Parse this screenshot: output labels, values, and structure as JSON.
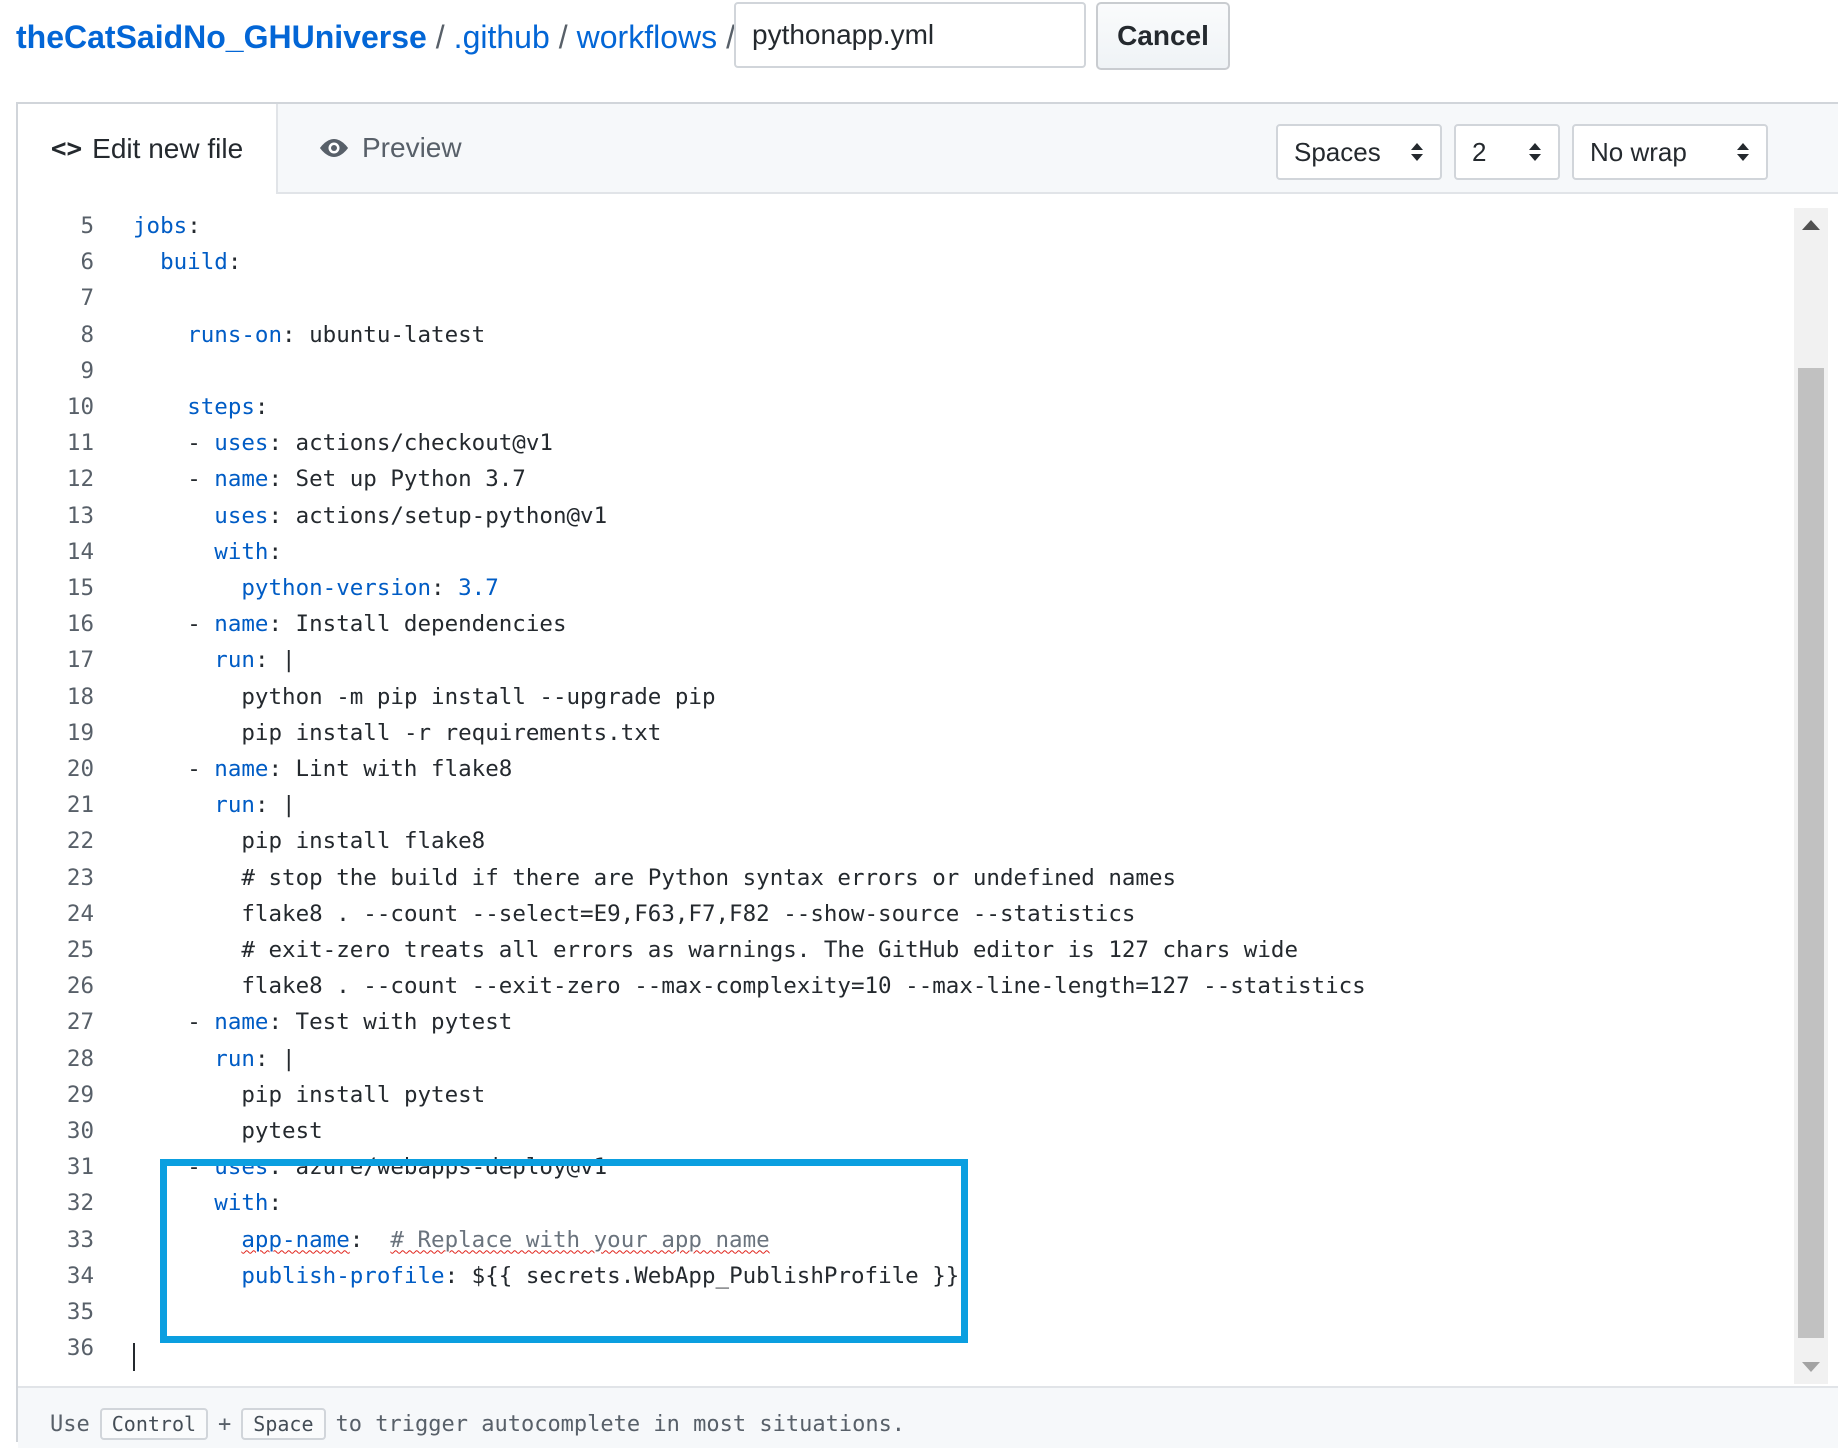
{
  "breadcrumb": {
    "repo": "theCatSaidNo_GHUniverse",
    "sep": "/",
    "folder1": ".github",
    "folder2": "workflows"
  },
  "filename_value": "pythonapp.yml",
  "cancel_label": "Cancel",
  "tabs": {
    "edit_icon": "<>",
    "edit_label": "Edit new file",
    "preview_label": "Preview"
  },
  "options": {
    "indent_mode": "Spaces",
    "indent_size": "2",
    "wrap_mode": "No wrap"
  },
  "code_lines": [
    {
      "n": "5",
      "indent": 0,
      "key": "jobs",
      "rest": ":"
    },
    {
      "n": "6",
      "indent": 2,
      "key": "build",
      "rest": ":"
    },
    {
      "n": "7",
      "indent": 0,
      "rest": ""
    },
    {
      "n": "8",
      "indent": 4,
      "key": "runs-on",
      "rest": ": ubuntu-latest"
    },
    {
      "n": "9",
      "indent": 0,
      "rest": ""
    },
    {
      "n": "10",
      "indent": 4,
      "key": "steps",
      "rest": ":"
    },
    {
      "n": "11",
      "indent": 4,
      "pre": "- ",
      "key": "uses",
      "rest": ": actions/checkout@v1"
    },
    {
      "n": "12",
      "indent": 4,
      "pre": "- ",
      "key": "name",
      "rest": ": Set up Python 3.7"
    },
    {
      "n": "13",
      "indent": 6,
      "key": "uses",
      "rest": ": actions/setup-python@v1"
    },
    {
      "n": "14",
      "indent": 6,
      "key": "with",
      "rest": ":"
    },
    {
      "n": "15",
      "indent": 8,
      "key": "python-version",
      "rest": ": ",
      "val": "3.7"
    },
    {
      "n": "16",
      "indent": 4,
      "pre": "- ",
      "key": "name",
      "rest": ": Install dependencies"
    },
    {
      "n": "17",
      "indent": 6,
      "key": "run",
      "rest": ": |"
    },
    {
      "n": "18",
      "indent": 8,
      "rest": "python -m pip install --upgrade pip"
    },
    {
      "n": "19",
      "indent": 8,
      "rest": "pip install -r requirements.txt"
    },
    {
      "n": "20",
      "indent": 4,
      "pre": "- ",
      "key": "name",
      "rest": ": Lint with flake8"
    },
    {
      "n": "21",
      "indent": 6,
      "key": "run",
      "rest": ": |"
    },
    {
      "n": "22",
      "indent": 8,
      "rest": "pip install flake8"
    },
    {
      "n": "23",
      "indent": 8,
      "rest": "# stop the build if there are Python syntax errors or undefined names"
    },
    {
      "n": "24",
      "indent": 8,
      "rest": "flake8 . --count --select=E9,F63,F7,F82 --show-source --statistics"
    },
    {
      "n": "25",
      "indent": 8,
      "rest": "# exit-zero treats all errors as warnings. The GitHub editor is 127 chars wide"
    },
    {
      "n": "26",
      "indent": 8,
      "rest": "flake8 . --count --exit-zero --max-complexity=10 --max-line-length=127 --statistics"
    },
    {
      "n": "27",
      "indent": 4,
      "pre": "- ",
      "key": "name",
      "rest": ": Test with pytest"
    },
    {
      "n": "28",
      "indent": 6,
      "key": "run",
      "rest": ": |"
    },
    {
      "n": "29",
      "indent": 8,
      "rest": "pip install pytest"
    },
    {
      "n": "30",
      "indent": 8,
      "rest": "pytest"
    },
    {
      "n": "31",
      "indent": 4,
      "pre": "- ",
      "key": "uses",
      "rest": ": azure/webapps-deploy@v1"
    },
    {
      "n": "32",
      "indent": 6,
      "key": "with",
      "rest": ":"
    },
    {
      "n": "33",
      "indent": 8,
      "key": "app-name",
      "rest": ":  ",
      "comment": "# Replace with your app name",
      "squiggle": true
    },
    {
      "n": "34",
      "indent": 8,
      "key": "publish-profile",
      "rest": ": ${{ secrets.WebApp_PublishProfile }}"
    },
    {
      "n": "35",
      "indent": 0,
      "rest": ""
    },
    {
      "n": "36",
      "indent": 0,
      "rest": ""
    }
  ],
  "footer": {
    "prefix": "Use",
    "key1": "Control",
    "plus": "+",
    "key2": "Space",
    "suffix": "to trigger autocomplete in most situations."
  },
  "colors": {
    "link": "#0366d6",
    "yaml_key": "#005cc5",
    "highlight_box": "#0b9fe0",
    "squiggle": "#e0241c"
  }
}
